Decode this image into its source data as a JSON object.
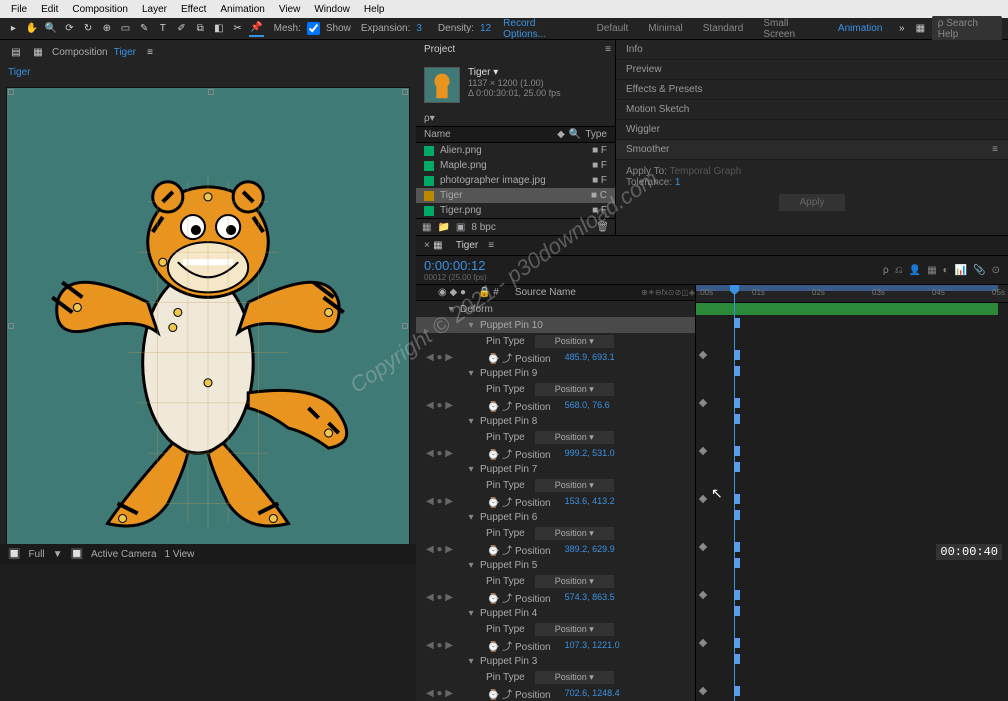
{
  "menu": [
    "File",
    "Edit",
    "Composition",
    "Layer",
    "Effect",
    "Animation",
    "View",
    "Window",
    "Help"
  ],
  "toolbar": {
    "mesh_label": "Mesh:",
    "show_label": "Show",
    "expansion_label": "Expansion:",
    "expansion_value": "3",
    "density_label": "Density:",
    "density_value": "12",
    "record_options": "Record Options...",
    "workspaces": [
      "Default",
      "Minimal",
      "Standard",
      "Small Screen",
      "Animation"
    ],
    "active_workspace": "Animation",
    "search_placeholder": "Search Help"
  },
  "composition": {
    "header": "Composition",
    "name": "Tiger"
  },
  "project": {
    "tab": "Project",
    "selected_name": "Tiger ▾",
    "selected_dims": "1137 × 1200 (1.00)",
    "selected_dur": "Δ 0:00:30:01, 25.00 fps",
    "search_placeholder": "ρ▾",
    "columns": [
      "Name",
      "Type"
    ],
    "items": [
      {
        "name": "Alien.png",
        "icon": "#0a6"
      },
      {
        "name": "Maple.png",
        "icon": "#0a6"
      },
      {
        "name": "photographer image.jpg",
        "icon": "#0a6"
      },
      {
        "name": "Tiger",
        "icon": "#b80",
        "selected": true
      },
      {
        "name": "Tiger.png",
        "icon": "#0a6"
      }
    ],
    "bottom_bpc": "8 bpc"
  },
  "info_panel": {
    "items": [
      "Info",
      "Preview",
      "Effects & Presets",
      "Motion Sketch",
      "Wiggler",
      "Smoother"
    ],
    "active": "Smoother",
    "apply_to_label": "Apply To:",
    "apply_to_value": "Temporal Graph",
    "tolerance_label": "Tolerance:",
    "tolerance_value": "1",
    "apply_btn": "Apply"
  },
  "timeline": {
    "tab": "Tiger",
    "timecode": "0:00:00:12",
    "sub_timecode": "00012 (25.00 fps)",
    "source_name_header": "Source Name",
    "ruler_ticks": [
      ":00s",
      "01s",
      "02s",
      "03s",
      "04s",
      "05s"
    ],
    "deform_label": "Deform",
    "pins": [
      {
        "name": "Puppet Pin 10",
        "value": "485.9, 693.1"
      },
      {
        "name": "Puppet Pin 9",
        "value": "568.0, 76.6"
      },
      {
        "name": "Puppet Pin 8",
        "value": "999.2, 531.0"
      },
      {
        "name": "Puppet Pin 7",
        "value": "153.6, 413.2"
      },
      {
        "name": "Puppet Pin 6",
        "value": "389.2, 629.9"
      },
      {
        "name": "Puppet Pin 5",
        "value": "574.3, 863.5"
      },
      {
        "name": "Puppet Pin 4",
        "value": "107.3, 1221.0"
      },
      {
        "name": "Puppet Pin 3",
        "value": "702.6, 1248.4"
      }
    ],
    "pin_type_label": "Pin Type",
    "position_label": "Position",
    "position_prop": "Position"
  },
  "footer": {
    "zoom": "Full",
    "camera": "Active Camera",
    "view": "1 View"
  },
  "watermark": "Copyright © 2021 - p30download.com",
  "corner_time": "00:00:40"
}
